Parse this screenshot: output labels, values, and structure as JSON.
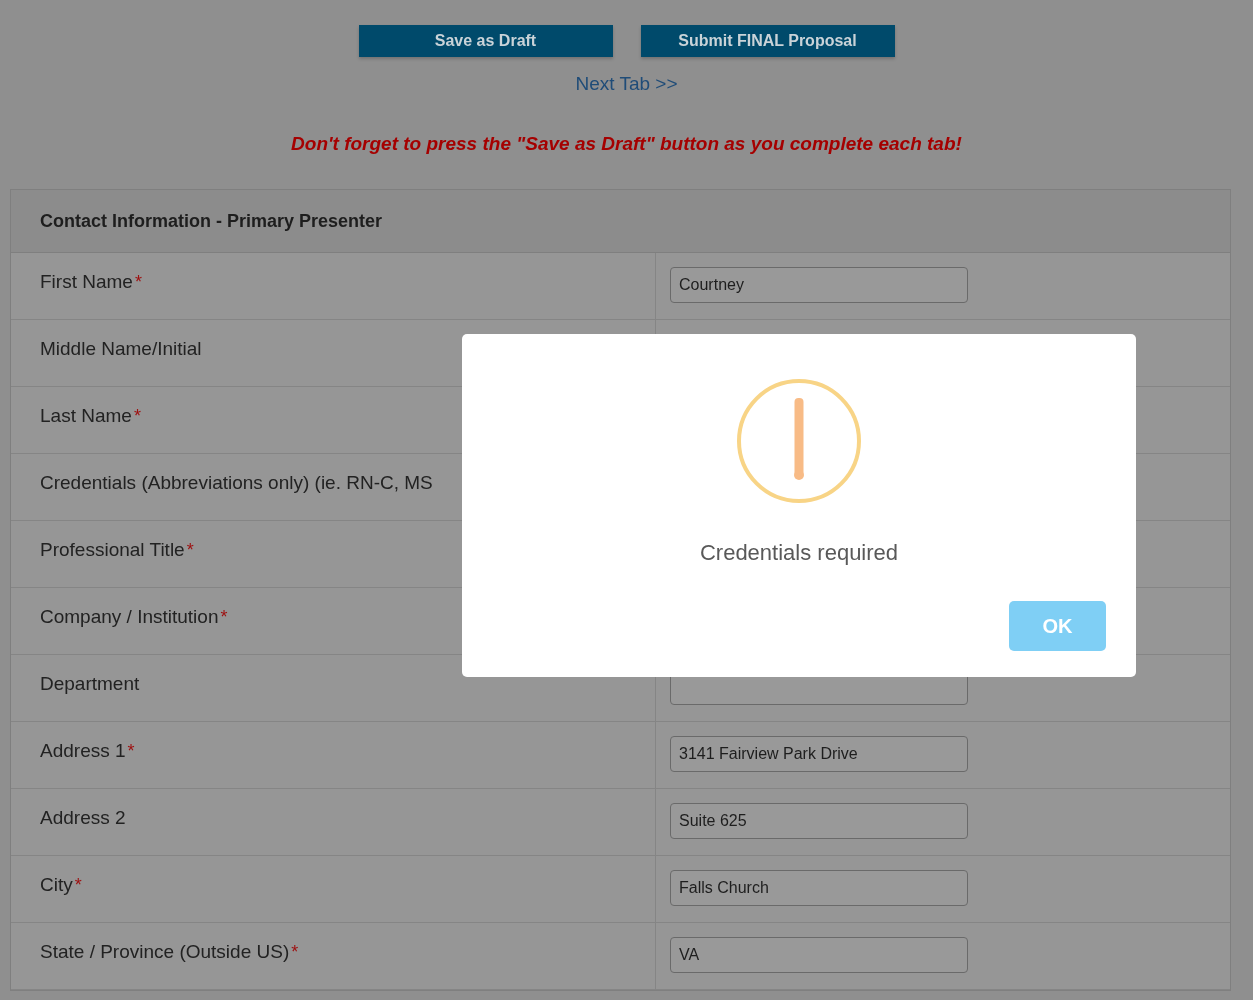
{
  "toolbar": {
    "buttons": [
      "Save as Draft",
      "Submit FINAL Proposal"
    ],
    "next_link": "Next Tab >>"
  },
  "reminder": "Don't forget to press the \"Save as Draft\" button as you complete each tab!",
  "panel": {
    "title": "Contact Information - Primary Presenter",
    "rows": [
      {
        "label": "First Name",
        "required_mark": "*",
        "field": {
          "value": "Courtney"
        }
      },
      {
        "label": "Middle Name/Initial"
      },
      {
        "label": "Last Name",
        "required_mark": "*"
      },
      {
        "label": "Credentials (Abbreviations only) (ie. RN-C, MS"
      },
      {
        "label": "Professional Title",
        "required_mark": "*"
      },
      {
        "label": "Company / Institution",
        "required_mark": "*"
      },
      {
        "label": "Department",
        "field": {}
      },
      {
        "label": "Address 1",
        "required_mark": "*",
        "field": {
          "value": "3141 Fairview Park Drive"
        }
      },
      {
        "label": "Address 2",
        "field": {
          "value": "Suite 625"
        }
      },
      {
        "label": "City",
        "required_mark": "*",
        "field": {
          "value": "Falls Church"
        }
      },
      {
        "label": "State / Province (Outside US)",
        "required_mark": "*",
        "field": {
          "value": "VA"
        }
      }
    ]
  },
  "dialog": {
    "kind": "warning",
    "message": "Credentials required",
    "button": "OK"
  }
}
